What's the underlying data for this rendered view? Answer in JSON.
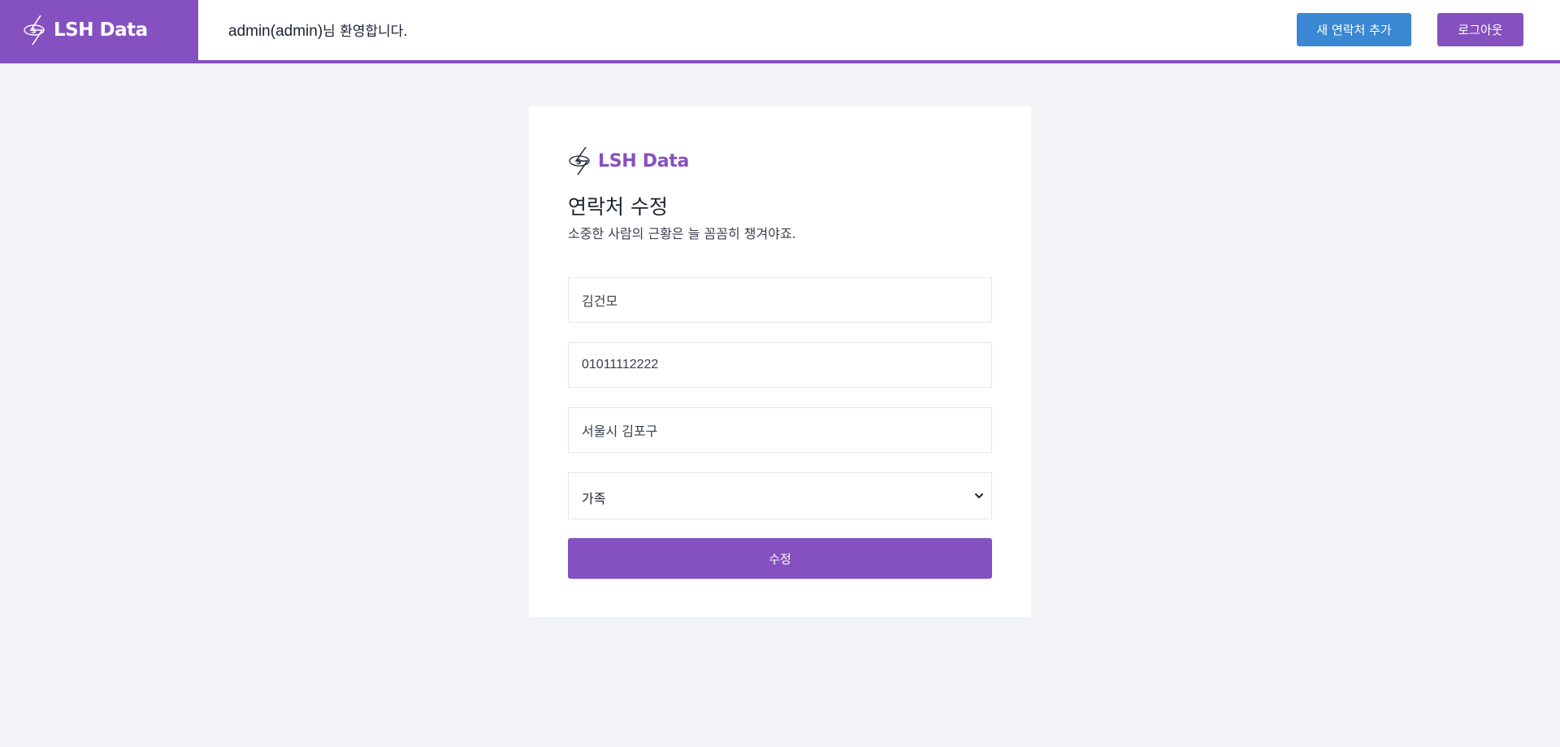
{
  "header": {
    "brand": "LSH Data",
    "welcome_user": "admin(admin)",
    "welcome_suffix": "님 환영합니다.",
    "add_contact_label": "새 연락처 추가",
    "logout_label": "로그아웃"
  },
  "form": {
    "brand": "LSH Data",
    "title": "연락처 수정",
    "subtitle": "소중한 사람의 근황은 늘 꼼꼼히 챙겨야죠.",
    "name_value": "김건모",
    "phone_value": "01011112222",
    "address_value": "서울시 김포구",
    "group_selected": "가족",
    "submit_label": "수정"
  },
  "colors": {
    "primary": "#8550c0",
    "secondary": "#3a88d4",
    "background": "#f3f4f8"
  },
  "icons": {
    "brand_logo": "lsh-data-logo-icon",
    "select_chevron": "chevron-down-icon"
  }
}
